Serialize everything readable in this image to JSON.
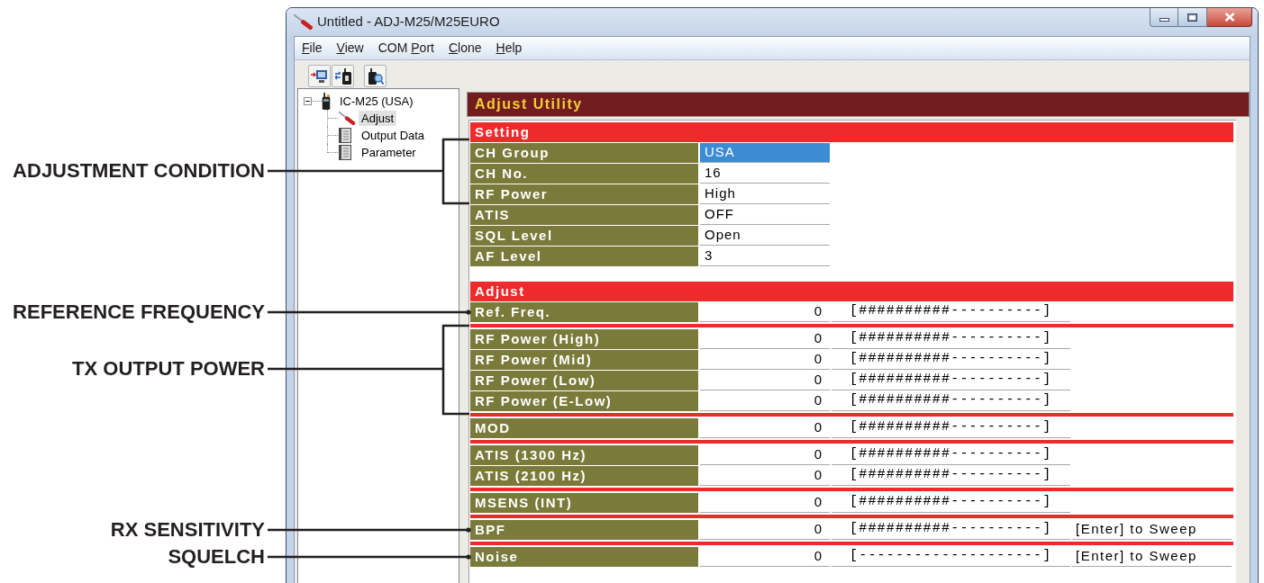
{
  "window": {
    "title": "Untitled - ADJ-M25/M25EURO"
  },
  "menu": [
    {
      "mnemonic": "F",
      "rest": "ile"
    },
    {
      "mnemonic": "V",
      "rest": "iew"
    },
    {
      "lead": "COM ",
      "mnemonic": "P",
      "rest": "ort"
    },
    {
      "mnemonic": "C",
      "rest": "lone"
    },
    {
      "mnemonic": "H",
      "rest": "elp"
    }
  ],
  "tree": {
    "label": "IC-M25 (USA)",
    "expanded": true,
    "selected": false,
    "children": [
      {
        "label": "Adjust",
        "kind": "tool",
        "selected": true
      },
      {
        "label": "Output Data",
        "kind": "document",
        "selected": false
      },
      {
        "label": "Parameter",
        "kind": "document",
        "selected": false
      }
    ]
  },
  "panel": {
    "title": "Adjust Utility",
    "setting": {
      "title": "Setting",
      "rows": [
        {
          "label": "CH Group",
          "value": "USA",
          "selected": true
        },
        {
          "label": "CH No.",
          "value": "16",
          "selected": false
        },
        {
          "label": "RF Power",
          "value": "High",
          "selected": false
        },
        {
          "label": "ATIS",
          "value": "OFF",
          "selected": false
        },
        {
          "label": "SQL Level",
          "value": "Open",
          "selected": false
        },
        {
          "label": "AF Level",
          "value": "3",
          "selected": false
        }
      ]
    },
    "adjust": {
      "title": "Adjust",
      "groups": [
        {
          "rows": [
            {
              "label": "Ref. Freq.",
              "value": "0",
              "bar": "[##########----------]",
              "selected": false
            }
          ]
        },
        {
          "rows": [
            {
              "label": "RF Power (High)",
              "value": "0",
              "bar": "[##########----------]",
              "selected": false
            },
            {
              "label": "RF Power (Mid)",
              "value": "0",
              "bar": "[##########----------]",
              "selected": false
            },
            {
              "label": "RF Power (Low)",
              "value": "0",
              "bar": "[##########----------]",
              "selected": false
            },
            {
              "label": "RF Power (E-Low)",
              "value": "0",
              "bar": "[##########----------]",
              "selected": false
            }
          ]
        },
        {
          "rows": [
            {
              "label": "MOD",
              "value": "0",
              "bar": "[##########----------]",
              "selected": false
            }
          ]
        },
        {
          "rows": [
            {
              "label": "ATIS (1300 Hz)",
              "value": "0",
              "bar": "[##########----------]",
              "selected": false
            },
            {
              "label": "ATIS (2100 Hz)",
              "value": "0",
              "bar": "[##########----------]",
              "selected": false
            }
          ]
        },
        {
          "rows": [
            {
              "label": "MSENS (INT)",
              "value": "0",
              "bar": "[##########----------]",
              "selected": false
            }
          ]
        },
        {
          "rows": [
            {
              "label": "BPF",
              "value": "0",
              "bar": "[##########----------]",
              "sweep": "[Enter] to Sweep",
              "selected": false
            }
          ]
        },
        {
          "rows": [
            {
              "label": "Noise",
              "value": "0",
              "bar": "[--------------------]",
              "sweep": "[Enter] to Sweep",
              "selected": false
            }
          ]
        }
      ]
    }
  },
  "callouts": [
    {
      "label": "ADJUSTMENT CONDITION",
      "kind": "bracket"
    },
    {
      "label": "REFERENCE FREQUENCY",
      "kind": "pointer"
    },
    {
      "label": "TX OUTPUT POWER",
      "kind": "bracket"
    },
    {
      "label": "RX SENSITIVITY",
      "kind": "pointer"
    },
    {
      "label": "SQUELCH",
      "kind": "pointer"
    }
  ]
}
